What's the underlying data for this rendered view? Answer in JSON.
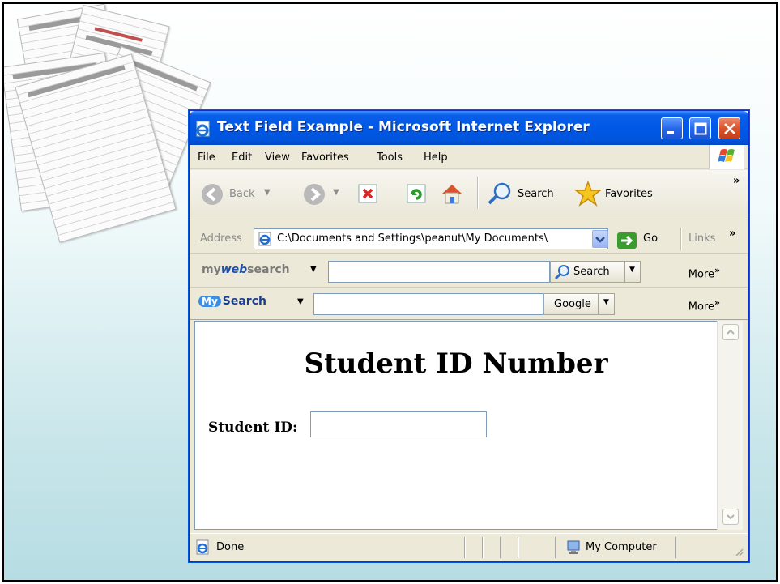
{
  "window": {
    "title": "Text Field Example - Microsoft Internet Explorer"
  },
  "menu": [
    "File",
    "Edit",
    "View",
    "Favorites",
    "Tools",
    "Help"
  ],
  "toolbar": {
    "back_label": "Back",
    "search_label": "Search",
    "favorites_label": "Favorites",
    "overflow": "»"
  },
  "address": {
    "label": "Address",
    "value": "C:\\Documents and Settings\\peanut\\My Documents\\",
    "go_label": "Go",
    "links_label": "Links",
    "overflow": "»"
  },
  "mywebsearch": {
    "brand_my": "my",
    "brand_web": "web",
    "brand_search": "search",
    "input_value": "",
    "search_button": "Search",
    "more_label": "More"
  },
  "mysearch": {
    "brand_badge": "My",
    "brand_label": "Search",
    "input_value": "",
    "engine_button": "Google",
    "more_label": "More"
  },
  "page": {
    "heading": "Student ID Number",
    "field_label": "Student ID:",
    "field_value": ""
  },
  "status": {
    "text": "Done",
    "zone": "My Computer"
  },
  "colors": {
    "titlebar": "#0058e6",
    "chrome": "#ece9d8",
    "slide_gradient_end": "#b6dde3"
  }
}
